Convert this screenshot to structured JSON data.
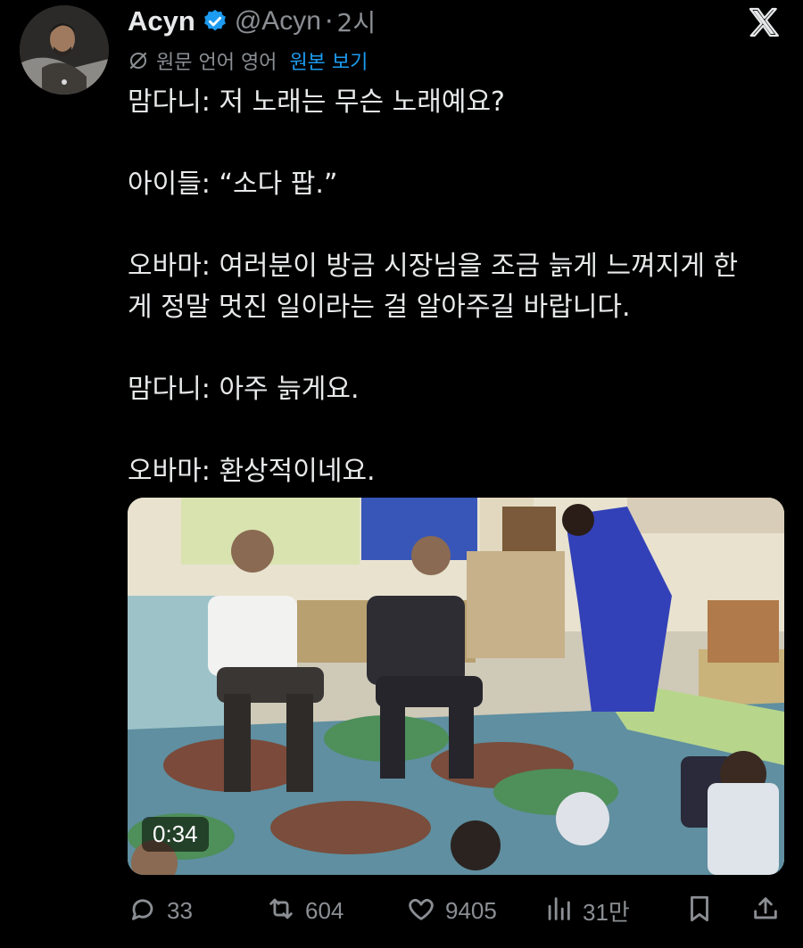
{
  "author": {
    "name": "Acyn",
    "handle": "@Acyn",
    "separator": "·",
    "time": "2시"
  },
  "translation": {
    "label": "원문 언어 영어",
    "show_original": "원본 보기"
  },
  "tweet": {
    "paragraphs": [
      [
        "맘다니: 저 노래는 무슨 노래예요?"
      ],
      [
        "아이들: “소다 팝.”"
      ],
      [
        "오바마: 여러분이 방금 시장님을 조금 늙게 느껴지게 한",
        "게 정말 멋진 일이라는 걸 알아주길 바랍니다."
      ],
      [
        "맘다니: 아주 늙게요."
      ],
      [
        "오바마: 환상적이네요."
      ]
    ]
  },
  "media": {
    "duration": "0:34"
  },
  "actions": {
    "replies": "33",
    "reposts": "604",
    "likes": "9405",
    "views": "31만"
  },
  "colors": {
    "background": "#000000",
    "text": "#e7e9ea",
    "muted": "#8b8f94",
    "accent": "#1d9bf0",
    "verified": "#1d9bf0"
  },
  "icons": {
    "verified": "verified-badge-icon",
    "brand": "x-logo-icon",
    "translate": "globe-slash-icon",
    "reply": "speech-bubble-icon",
    "repost": "repost-arrows-icon",
    "like": "heart-icon",
    "views": "bar-chart-icon",
    "bookmark": "bookmark-icon",
    "share": "share-upload-icon"
  }
}
